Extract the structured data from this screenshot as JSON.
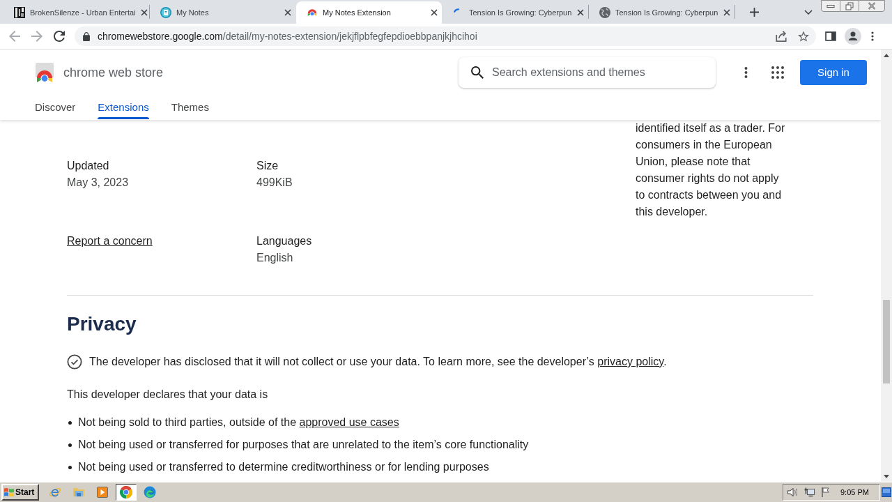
{
  "browser": {
    "tabs": [
      {
        "title": "BrokenSilenze - Urban Entertai",
        "selected": false,
        "loading": false
      },
      {
        "title": "My Notes",
        "selected": false,
        "loading": false
      },
      {
        "title": "My Notes Extension",
        "selected": true,
        "loading": false
      },
      {
        "title": "Tension Is Growing: Cyberpun",
        "selected": false,
        "loading": true
      },
      {
        "title": "Tension Is Growing: Cyberpun",
        "selected": false,
        "loading": false
      }
    ],
    "address_bar": {
      "host": "chromewebstore.google.com",
      "path": "/detail/my-notes-extension/jekjflpbfegfepdioebbpanjkjhcihoi"
    }
  },
  "store_header": {
    "name": "chrome web store",
    "search": {
      "placeholder": "Search extensions and themes"
    },
    "sign_in": "Sign in",
    "nav": [
      {
        "label": "Discover",
        "selected": false
      },
      {
        "label": "Extensions",
        "selected": true
      },
      {
        "label": "Themes",
        "selected": false
      }
    ]
  },
  "trader_notice": "identified itself as a trader. For consumers in the European Union, please note that consumer rights do not apply to contracts between you and this developer.",
  "details": [
    {
      "kind": "field",
      "label": "Updated",
      "value": "May 3, 2023"
    },
    {
      "kind": "field",
      "label": "Size",
      "value": "499KiB"
    },
    {
      "kind": "link",
      "label": "Report a concern"
    },
    {
      "kind": "field",
      "label": "Languages",
      "value": "English"
    }
  ],
  "privacy": {
    "title": "Privacy",
    "disclosure": {
      "text": "The developer has disclosed that it will not collect or use your data. To learn more, see the developer’s ",
      "link": "privacy policy",
      "end": "."
    },
    "declares": "This developer declares that your data is",
    "items": [
      {
        "text": "Not being sold to third parties, outside of the ",
        "link": "approved use cases"
      },
      {
        "text": "Not being used or transferred for purposes that are unrelated to the item’s core functionality"
      },
      {
        "text": "Not being used or transferred to determine creditworthiness or for lending purposes"
      }
    ]
  },
  "taskbar": {
    "start": "Start",
    "apps": [
      {
        "selected": false
      },
      {
        "selected": false
      },
      {
        "selected": false
      },
      {
        "selected": true
      },
      {
        "selected": false
      }
    ],
    "clock": "9:05 PM"
  }
}
